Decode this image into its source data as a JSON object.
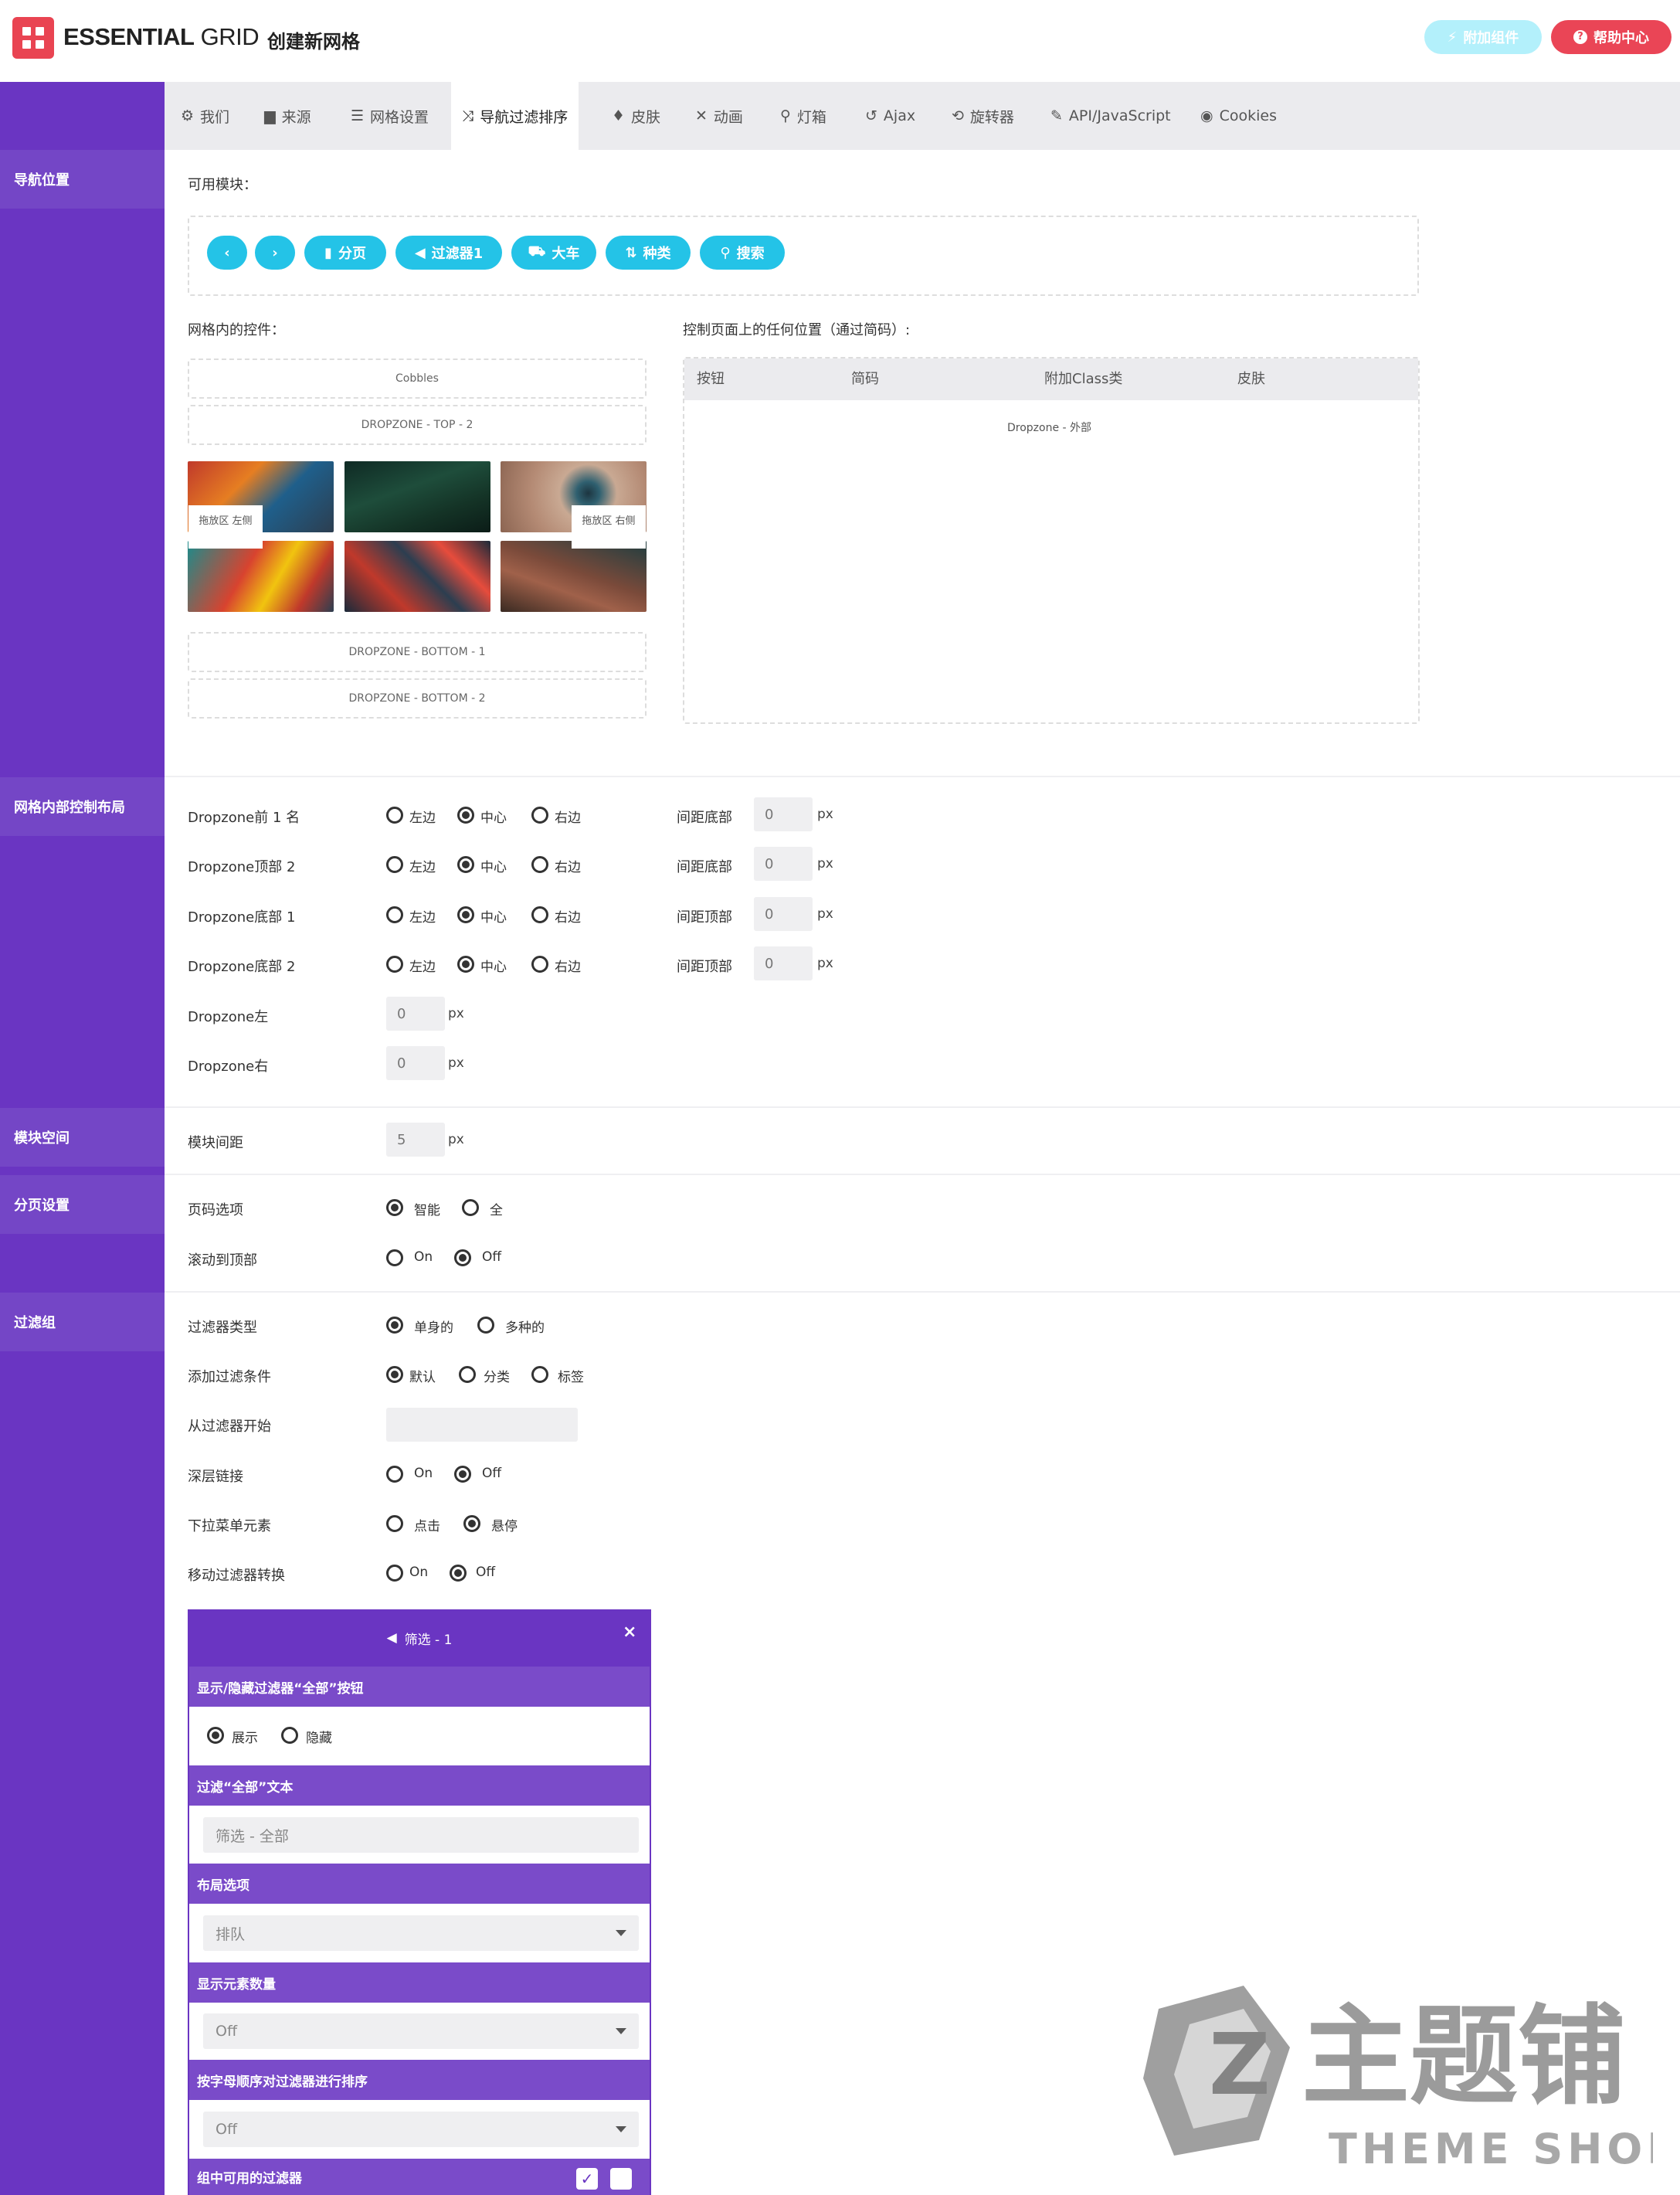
{
  "header": {
    "logo_bold": "ESSENTIAL",
    "logo_light": " GRID",
    "page_title": "创建新网格",
    "addon_button": "附加组件",
    "help_button": "帮助中心"
  },
  "tabs": [
    {
      "label": "我们",
      "icon": "gear-icon"
    },
    {
      "label": "来源",
      "icon": "folder-icon"
    },
    {
      "label": "网格设置",
      "icon": "bars-icon"
    },
    {
      "label": "导航过滤排序",
      "icon": "shuffle-icon"
    },
    {
      "label": "皮肤",
      "icon": "droplet-icon"
    },
    {
      "label": "动画",
      "icon": "tools-icon"
    },
    {
      "label": "灯箱",
      "icon": "search-icon"
    },
    {
      "label": "Ajax",
      "icon": "undo-icon"
    },
    {
      "label": "旋转器",
      "icon": "history-icon"
    },
    {
      "label": "API/JavaScript",
      "icon": "magic-wand-icon"
    },
    {
      "label": "Cookies",
      "icon": "eye-icon"
    }
  ],
  "sidebar": {
    "nav_position": "导航位置",
    "inner_layout": "网格内部控制布局",
    "module_space": "模块空间",
    "pagination": "分页设置",
    "filter_group": "过滤组"
  },
  "modules": {
    "available_label": "可用模块：",
    "buttons": [
      "分页",
      "过滤器1",
      "大车",
      "种类",
      "搜索"
    ],
    "prev_icon": "chevron-left-icon",
    "next_icon": "chevron-right-icon"
  },
  "inner": {
    "label": "网格内的控件：",
    "cobbles": "Cobbles",
    "top2": "DROPZONE - TOP - 2",
    "bottom1": "DROPZONE - BOTTOM - 1",
    "bottom2": "DROPZONE - BOTTOM - 2",
    "left_zone": "拖放区 左侧",
    "right_zone": "拖放区 右侧"
  },
  "external": {
    "label": "控制页面上的任何位置（通过简码）:",
    "columns": [
      "按钮",
      "简码",
      "附加Class类",
      "皮肤"
    ],
    "zone": "Dropzone - 外部"
  },
  "layout_rows": [
    {
      "label": "Dropzone前 1 名",
      "options": [
        "左边",
        "中心",
        "右边"
      ],
      "selected": 1,
      "spacing_label": "间距底部",
      "spacing": "0",
      "unit": "px"
    },
    {
      "label": "Dropzone顶部 2",
      "options": [
        "左边",
        "中心",
        "右边"
      ],
      "selected": 1,
      "spacing_label": "间距底部",
      "spacing": "0",
      "unit": "px"
    },
    {
      "label": "Dropzone底部 1",
      "options": [
        "左边",
        "中心",
        "右边"
      ],
      "selected": 1,
      "spacing_label": "间距顶部",
      "spacing": "0",
      "unit": "px"
    },
    {
      "label": "Dropzone底部 2",
      "options": [
        "左边",
        "中心",
        "右边"
      ],
      "selected": 1,
      "spacing_label": "间距顶部",
      "spacing": "0",
      "unit": "px"
    }
  ],
  "side_rows": [
    {
      "label": "Dropzone左",
      "value": "0",
      "unit": "px"
    },
    {
      "label": "Dropzone右",
      "value": "0",
      "unit": "px"
    }
  ],
  "module_gap": {
    "label": "模块间距",
    "value": "5",
    "unit": "px"
  },
  "pagination": {
    "page_options": {
      "label": "页码选项",
      "options": [
        "智能",
        "全"
      ],
      "selected": 0
    },
    "scroll_top": {
      "label": "滚动到顶部",
      "options": [
        "On",
        "Off"
      ],
      "selected": 1
    }
  },
  "filters": {
    "filter_type": {
      "label": "过滤器类型",
      "options": [
        "单身的",
        "多种的"
      ],
      "selected": 0
    },
    "add_condition": {
      "label": "添加过滤条件",
      "options": [
        "默认",
        "分类",
        "标签"
      ],
      "selected": 0
    },
    "start_from": {
      "label": "从过滤器开始",
      "value": ""
    },
    "deep_link": {
      "label": "深层链接",
      "options": [
        "On",
        "Off"
      ],
      "selected": 1
    },
    "dropdown_elem": {
      "label": "下拉菜单元素",
      "options": [
        "点击",
        "悬停"
      ],
      "selected": 1
    },
    "mobile_convert": {
      "label": "移动过滤器转换",
      "options": [
        "On",
        "Off"
      ],
      "selected": 1
    }
  },
  "filter_panel": {
    "title": "筛选 - 1",
    "close": "×",
    "show_hide_all": "显示/隐藏过滤器“全部”按钮",
    "show_option": "展示",
    "hide_option": "隐藏",
    "all_text_label": "过滤“全部”文本",
    "all_text_value": "筛选 - 全部",
    "layout_label": "布局选项",
    "layout_value": "排队",
    "count_label": "显示元素数量",
    "count_value": "Off",
    "sort_label": "按字母顺序对过滤器进行排序",
    "sort_value": "Off",
    "available_label": "组中可用的过滤器"
  },
  "watermark": {
    "main": "主题铺",
    "sub": "THEME SHOP"
  },
  "colors": {
    "purple": "#6a35c2",
    "cyan": "#24c3e7",
    "red": "#ea4556"
  }
}
